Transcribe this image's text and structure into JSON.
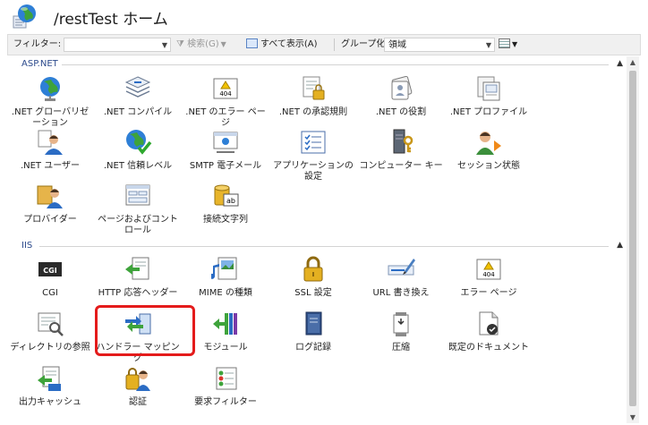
{
  "header": {
    "title": "/restTest ホーム"
  },
  "filterbar": {
    "filter_label": "フィルター:",
    "search_label": "検索(G)",
    "show_all_label": "すべて表示(A)",
    "group_label": "グループ化:",
    "group_value": "領域"
  },
  "groups": [
    {
      "name": "ASP.NET",
      "items": [
        {
          "label": ".NET グローバリゼーション",
          "icon": "globe-icon"
        },
        {
          "label": ".NET コンパイル",
          "icon": "compile-icon"
        },
        {
          "label": ".NET のエラー ページ",
          "icon": "error-page-icon"
        },
        {
          "label": ".NET の承認規則",
          "icon": "authorization-icon"
        },
        {
          "label": ".NET の役割",
          "icon": "roles-icon"
        },
        {
          "label": ".NET プロファイル",
          "icon": "profile-icon"
        },
        {
          "label": ".NET ユーザー",
          "icon": "users-icon"
        },
        {
          "label": ".NET 信頼レベル",
          "icon": "trust-level-icon"
        },
        {
          "label": "SMTP 電子メール",
          "icon": "smtp-email-icon"
        },
        {
          "label": "アプリケーションの設定",
          "icon": "app-settings-icon"
        },
        {
          "label": "コンピューター キー",
          "icon": "machine-key-icon"
        },
        {
          "label": "セッション状態",
          "icon": "session-state-icon"
        },
        {
          "label": "プロバイダー",
          "icon": "providers-icon"
        },
        {
          "label": "ページおよびコントロール",
          "icon": "pages-controls-icon"
        },
        {
          "label": "接続文字列",
          "icon": "connection-strings-icon"
        }
      ]
    },
    {
      "name": "IIS",
      "items": [
        {
          "label": "CGI",
          "icon": "cgi-icon"
        },
        {
          "label": "HTTP 応答ヘッダー",
          "icon": "http-headers-icon"
        },
        {
          "label": "MIME の種類",
          "icon": "mime-types-icon"
        },
        {
          "label": "SSL 設定",
          "icon": "ssl-lock-icon"
        },
        {
          "label": "URL 書き換え",
          "icon": "url-rewrite-icon"
        },
        {
          "label": "エラー ページ",
          "icon": "error-page-icon"
        },
        {
          "label": "ディレクトリの参照",
          "icon": "directory-browsing-icon"
        },
        {
          "label": "ハンドラー マッピング",
          "icon": "handler-mappings-icon"
        },
        {
          "label": "モジュール",
          "icon": "modules-icon"
        },
        {
          "label": "ログ記録",
          "icon": "logging-icon"
        },
        {
          "label": "圧縮",
          "icon": "compression-icon"
        },
        {
          "label": "既定のドキュメント",
          "icon": "default-document-icon"
        },
        {
          "label": "出力キャッシュ",
          "icon": "output-cache-icon"
        },
        {
          "label": "認証",
          "icon": "authentication-icon"
        },
        {
          "label": "要求フィルター",
          "icon": "request-filtering-icon"
        }
      ]
    }
  ],
  "icon_text": {
    "cgi": "CGI",
    "err_code": "404",
    "ab": "ab"
  },
  "colors": {
    "highlight": "#e41b1b",
    "group_heading": "#2c4a8c",
    "accent_blue": "#2b6cc4"
  }
}
